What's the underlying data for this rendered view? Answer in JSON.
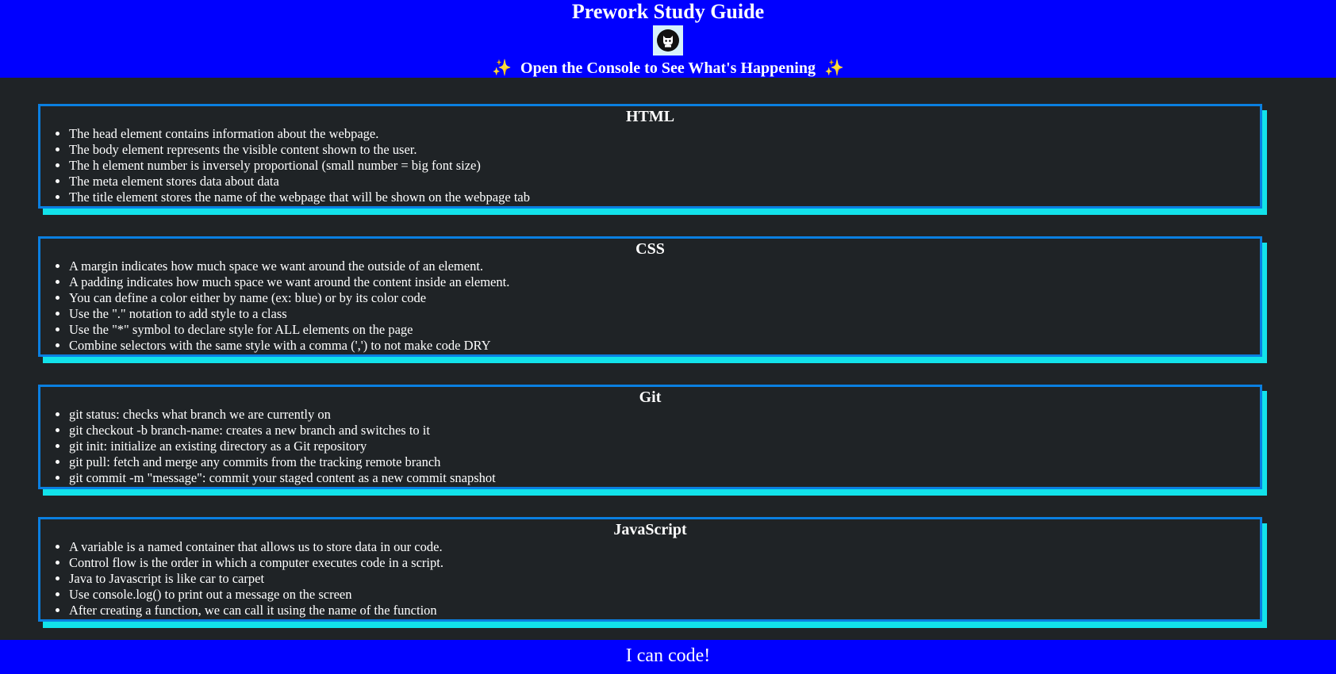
{
  "header": {
    "title": "Prework Study Guide",
    "logo_icon": "github-octocat-icon",
    "subtitle": "Open the Console to See What's Happening",
    "sparkle": "✨"
  },
  "sections": [
    {
      "title": "HTML",
      "items": [
        "The head element contains information about the webpage.",
        "The body element represents the visible content shown to the user.",
        "The h element number is inversely proportional (small number = big font size)",
        "The meta element stores data about data",
        "The title element stores the name of the webpage that will be shown on the webpage tab"
      ]
    },
    {
      "title": "CSS",
      "items": [
        "A margin indicates how much space we want around the outside of an element.",
        "A padding indicates how much space we want around the content inside an element.",
        "You can define a color either by name (ex: blue) or by its color code",
        "Use the \".\" notation to add style to a class",
        "Use the \"*\" symbol to declare style for ALL elements on the page",
        "Combine selectors with the same style with a comma (',') to not make code DRY"
      ]
    },
    {
      "title": "Git",
      "items": [
        "git status: checks what branch we are currently on",
        "git checkout -b branch-name: creates a new branch and switches to it",
        "git init: initialize an existing directory as a Git repository",
        "git pull: fetch and merge any commits from the tracking remote branch",
        "git commit -m \"message\": commit your staged content as a new commit snapshot"
      ]
    },
    {
      "title": "JavaScript",
      "items": [
        "A variable is a named container that allows us to store data in our code.",
        "Control flow is the order in which a computer executes code in a script.",
        "Java to Javascript is like car to carpet",
        "Use console.log() to print out a message on the screen",
        "After creating a function, we can call it using the name of the function"
      ]
    }
  ],
  "footer": {
    "text": "I can code!"
  },
  "colors": {
    "header_bg": "#0000ff",
    "page_bg": "#1f2326",
    "card_border": "#0a7fe0",
    "card_shadow": "#12e2ea",
    "sparkle": "#ffe234"
  }
}
